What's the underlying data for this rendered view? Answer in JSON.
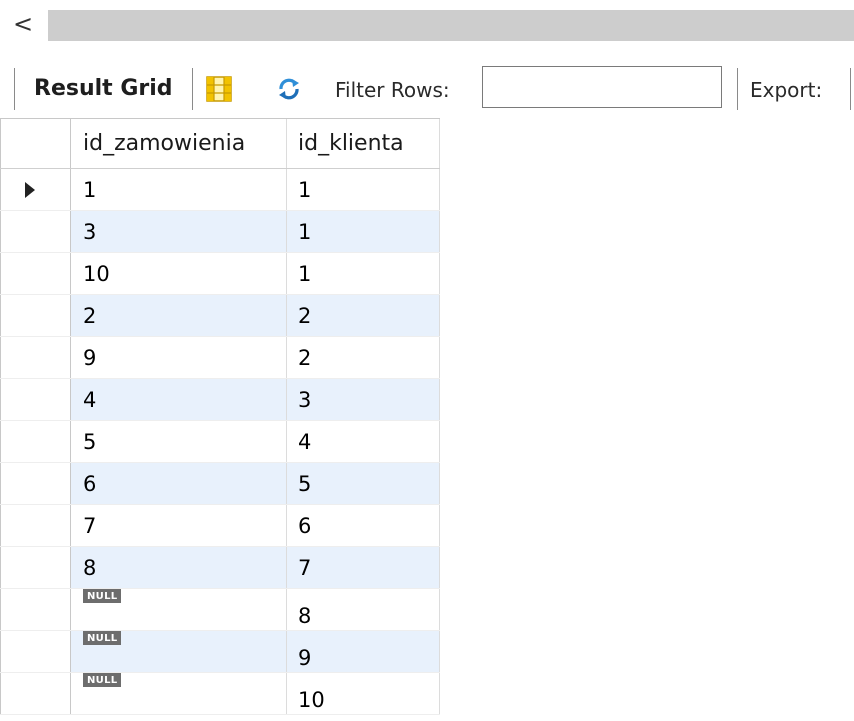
{
  "scrollbar": {
    "left_arrow": "<"
  },
  "toolbar": {
    "result_grid_label": "Result Grid",
    "grid_icon": "grid-layout-icon",
    "refresh_icon": "refresh-icon",
    "filter_label": "Filter Rows:",
    "filter_value": "",
    "export_label": "Export:"
  },
  "grid": {
    "columns": [
      "id_zamowienia",
      "id_klienta"
    ],
    "null_label": "NULL",
    "rows": [
      [
        "1",
        "1"
      ],
      [
        "3",
        "1"
      ],
      [
        "10",
        "1"
      ],
      [
        "2",
        "2"
      ],
      [
        "9",
        "2"
      ],
      [
        "4",
        "3"
      ],
      [
        "5",
        "4"
      ],
      [
        "6",
        "5"
      ],
      [
        "7",
        "6"
      ],
      [
        "8",
        "7"
      ],
      [
        null,
        "8"
      ],
      [
        null,
        "9"
      ],
      [
        null,
        "10"
      ]
    ]
  },
  "colors": {
    "alt_row": "#e8f1fc",
    "scroll_track": "#cdcdcd",
    "null_badge": "#6d6d6d"
  }
}
